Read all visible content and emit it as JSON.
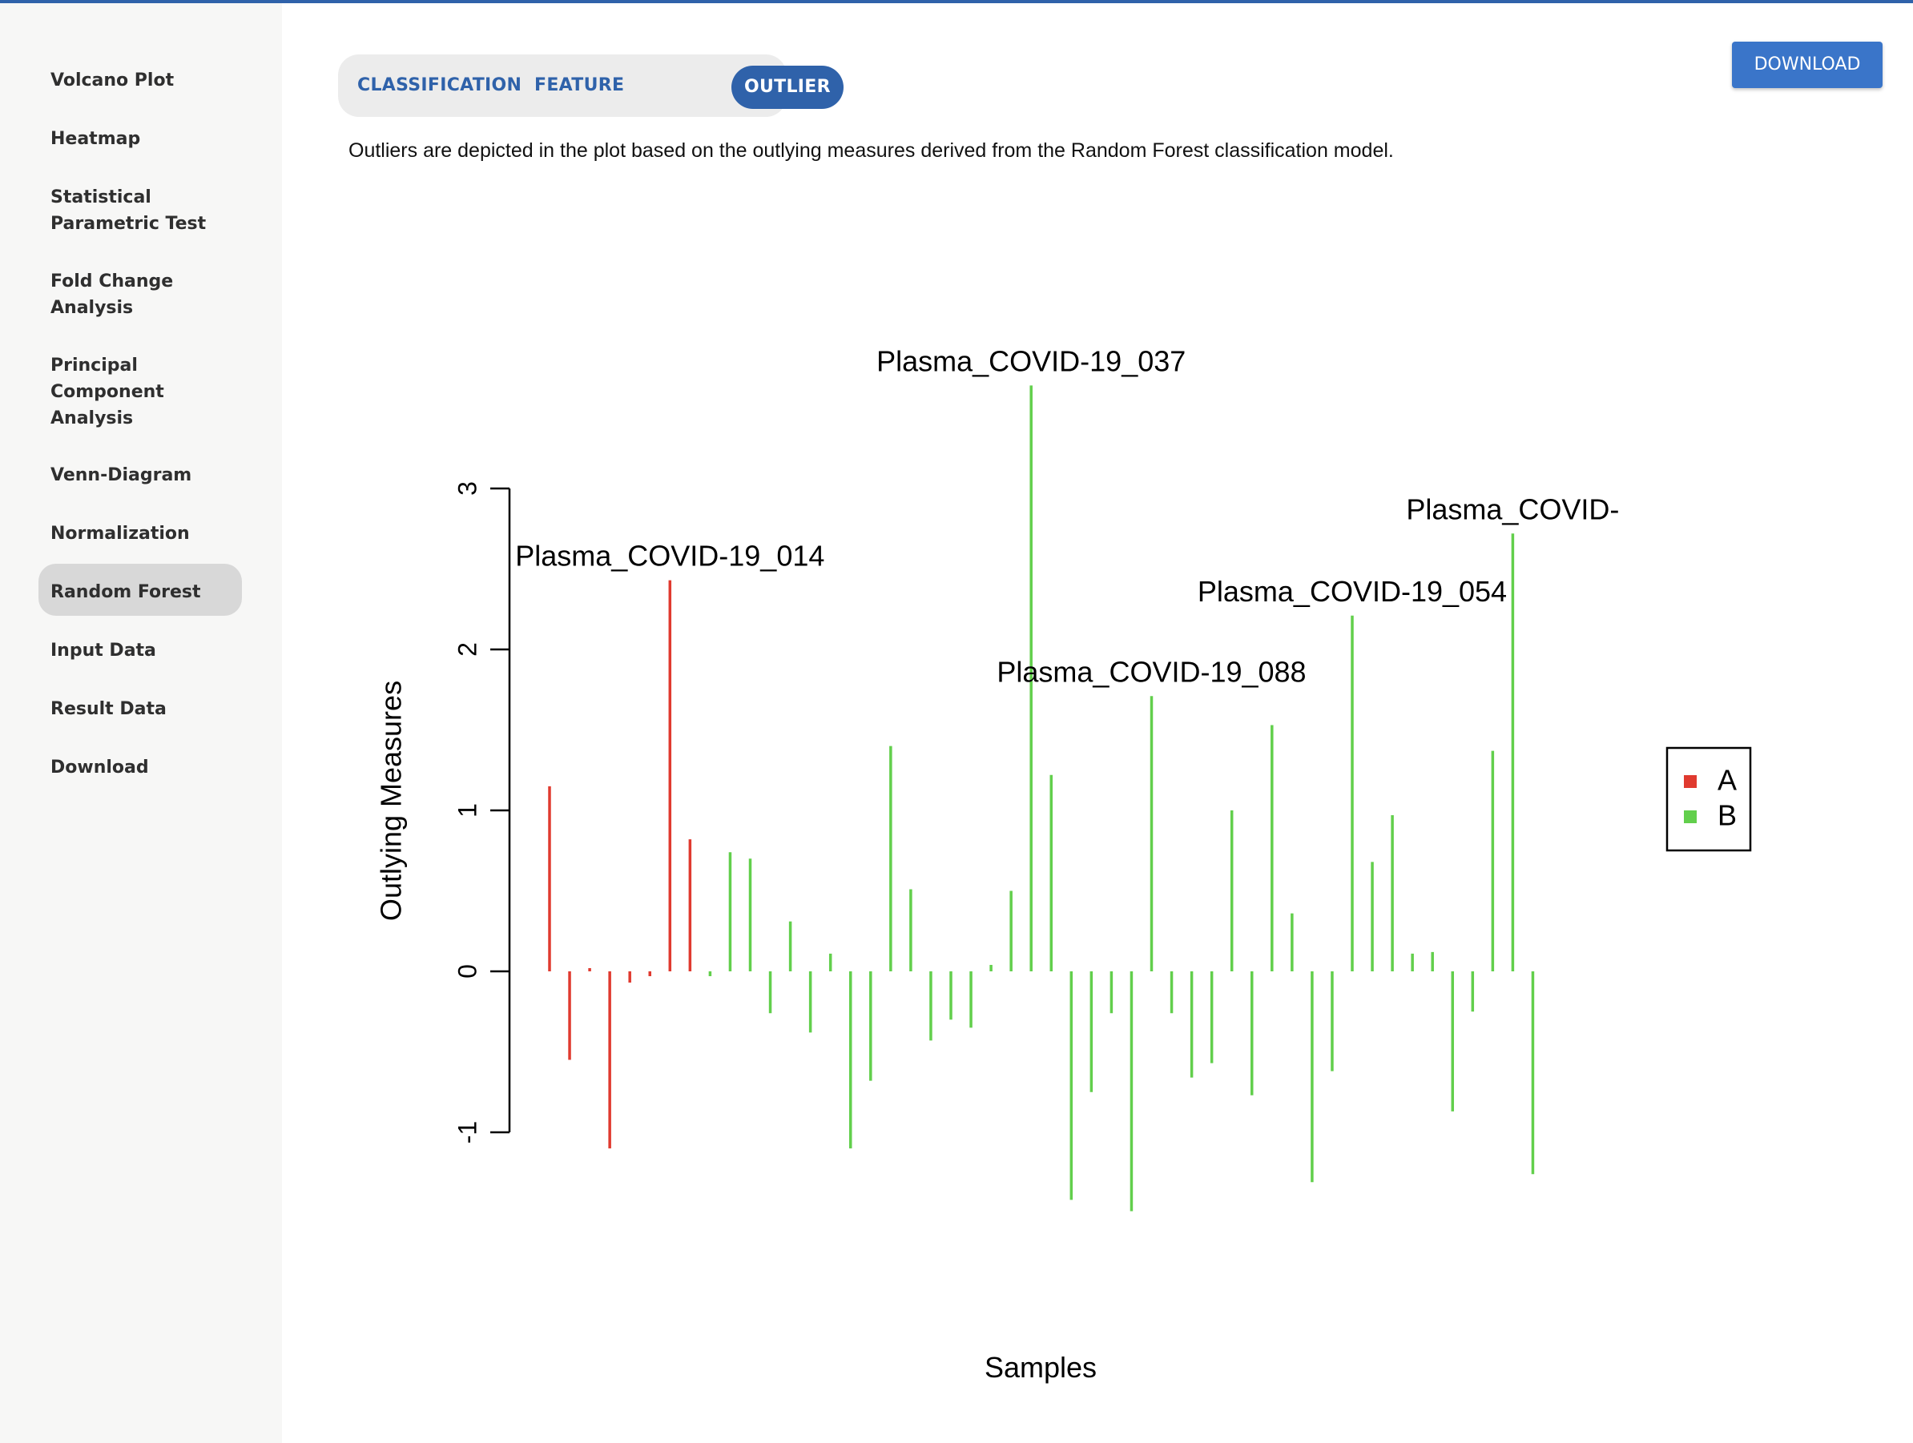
{
  "sidebar": {
    "items": [
      {
        "label": "Volcano Plot",
        "lines": [
          "Volcano Plot"
        ]
      },
      {
        "label": "Heatmap",
        "lines": [
          "Heatmap"
        ]
      },
      {
        "label": "Statistical Parametric Test",
        "lines": [
          "Statistical",
          "Parametric Test"
        ]
      },
      {
        "label": "Fold Change Analysis",
        "lines": [
          "Fold Change",
          "Analysis"
        ]
      },
      {
        "label": "Principal Component Analysis",
        "lines": [
          "Principal",
          "Component",
          "Analysis"
        ]
      },
      {
        "label": "Venn-Diagram",
        "lines": [
          "Venn-Diagram"
        ]
      },
      {
        "label": "Normalization",
        "lines": [
          "Normalization"
        ]
      },
      {
        "label": "Random Forest",
        "lines": [
          "Random Forest"
        ],
        "active": true
      },
      {
        "label": "Input Data",
        "lines": [
          "Input Data"
        ]
      },
      {
        "label": "Result Data",
        "lines": [
          "Result Data"
        ]
      },
      {
        "label": "Download",
        "lines": [
          "Download"
        ]
      }
    ]
  },
  "tabs": [
    {
      "label": "CLASSIFICATION",
      "active": false
    },
    {
      "label": "FEATURE",
      "active": false
    },
    {
      "label": "OUTLIER",
      "active": true
    }
  ],
  "download_label": "DOWNLOAD",
  "description": "Outliers are depicted in the plot based on the outlying measures derived from the Random Forest classification model.",
  "colors": {
    "accent": "#2f62aa",
    "button": "#3a75c9",
    "group_a": "#e03a2f",
    "group_b": "#62cf4c"
  },
  "chart_data": {
    "type": "bar",
    "xlabel": "Samples",
    "ylabel": "Outlying Measures",
    "ylim": [
      -1.5,
      3.7
    ],
    "yticks": [
      "-1",
      "0",
      "1",
      "2",
      "3"
    ],
    "legend": {
      "position": "right",
      "entries": [
        {
          "name": "A",
          "color": "#e03a2f"
        },
        {
          "name": "B",
          "color": "#62cf4c"
        }
      ]
    },
    "series": [
      {
        "name": "A",
        "values": [
          1.15,
          -0.55,
          0.02,
          -1.1,
          -0.07,
          -0.03,
          2.43,
          0.82
        ]
      },
      {
        "name": "B",
        "values": [
          -0.03,
          0.74,
          0.7,
          -0.26,
          0.31,
          -0.38,
          0.11,
          -1.1,
          -0.68,
          1.4,
          0.51,
          -0.43,
          -0.3,
          -0.35,
          0.04,
          0.5,
          3.64,
          1.22,
          -1.42,
          -0.75,
          -0.26,
          -1.49,
          1.71,
          -0.26,
          -0.66,
          -0.57,
          1.0,
          -0.77,
          1.53,
          0.36,
          -1.31,
          -0.62,
          2.21,
          0.68,
          0.97,
          0.11,
          0.12,
          -0.87,
          -0.25,
          1.37,
          2.72,
          -1.26
        ]
      }
    ],
    "annotations": [
      {
        "text": "Plasma_COVID-19_014",
        "series": "A",
        "index": 6
      },
      {
        "text": "Plasma_COVID-19_037",
        "series": "B",
        "index": 16
      },
      {
        "text": "Plasma_COVID-19_088",
        "series": "B",
        "index": 22
      },
      {
        "text": "Plasma_COVID-19_054",
        "series": "B",
        "index": 32
      },
      {
        "text": "Plasma_COVID-",
        "series": "B",
        "index": 40
      }
    ]
  }
}
